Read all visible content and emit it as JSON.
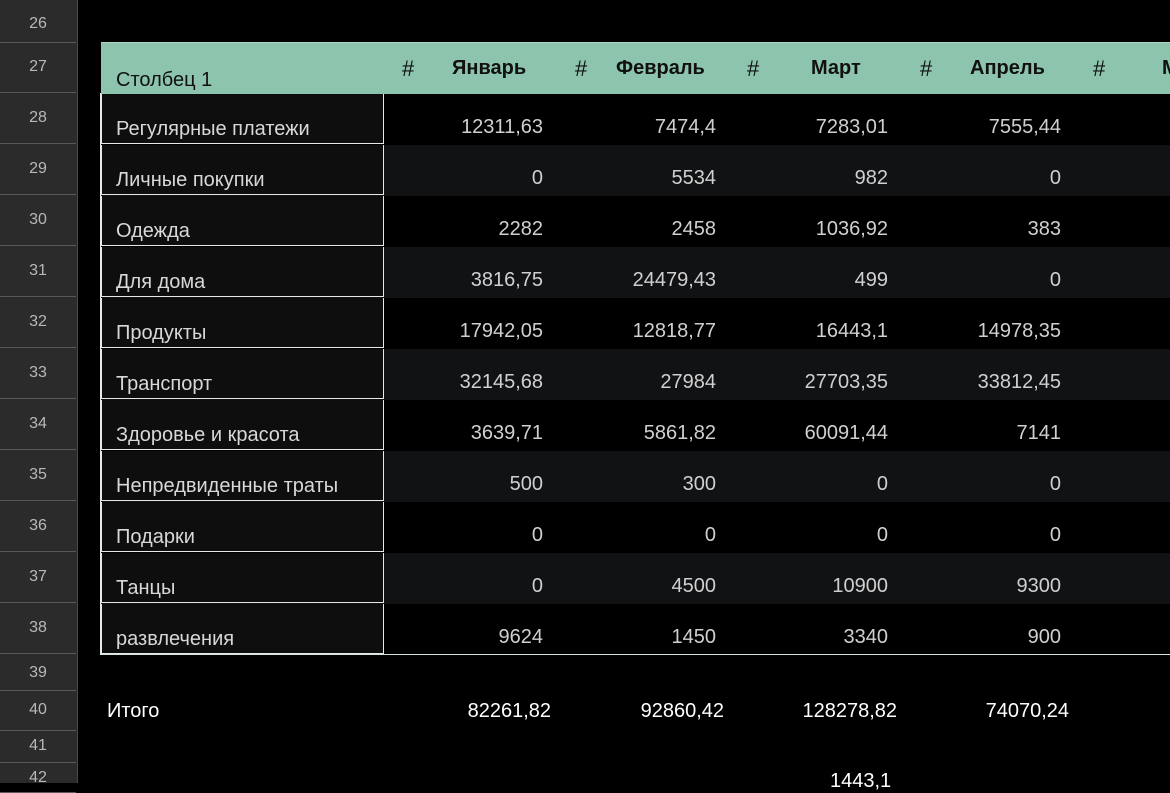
{
  "row_numbers": [
    "26",
    "27",
    "28",
    "29",
    "30",
    "31",
    "32",
    "33",
    "34",
    "35",
    "36",
    "37",
    "38",
    "39",
    "40",
    "41",
    "42"
  ],
  "header": {
    "first_col": "Столбец 1",
    "hash": "#",
    "months": [
      "Январь",
      "Февраль",
      "Март",
      "Апрель",
      "М"
    ]
  },
  "rows": [
    {
      "label": "Регулярные платежи",
      "values": [
        "12311,63",
        "7474,4",
        "7283,01",
        "7555,44"
      ]
    },
    {
      "label": "Личные покупки",
      "values": [
        "0",
        "5534",
        "982",
        "0"
      ]
    },
    {
      "label": "Одежда",
      "values": [
        "2282",
        "2458",
        "1036,92",
        "383"
      ]
    },
    {
      "label": "Для дома",
      "values": [
        "3816,75",
        "24479,43",
        "499",
        "0"
      ]
    },
    {
      "label": "Продукты",
      "values": [
        "17942,05",
        "12818,77",
        "16443,1",
        "14978,35"
      ]
    },
    {
      "label": "Транспорт",
      "values": [
        "32145,68",
        "27984",
        "27703,35",
        "33812,45"
      ]
    },
    {
      "label": "Здоровье и красота",
      "values": [
        "3639,71",
        "5861,82",
        "60091,44",
        "7141"
      ]
    },
    {
      "label": "Непредвиденные траты",
      "values": [
        "500",
        "300",
        "0",
        "0"
      ]
    },
    {
      "label": "Подарки",
      "values": [
        "0",
        "0",
        "0",
        "0"
      ]
    },
    {
      "label": "Танцы",
      "values": [
        "0",
        "4500",
        "10900",
        "9300"
      ]
    },
    {
      "label": "развлечения",
      "values": [
        "9624",
        "1450",
        "3340",
        "900"
      ]
    }
  ],
  "totals": {
    "label": "Итого",
    "values": [
      "82261,82",
      "92860,42",
      "128278,82",
      "74070,24"
    ]
  },
  "partial_value": "1443,1"
}
